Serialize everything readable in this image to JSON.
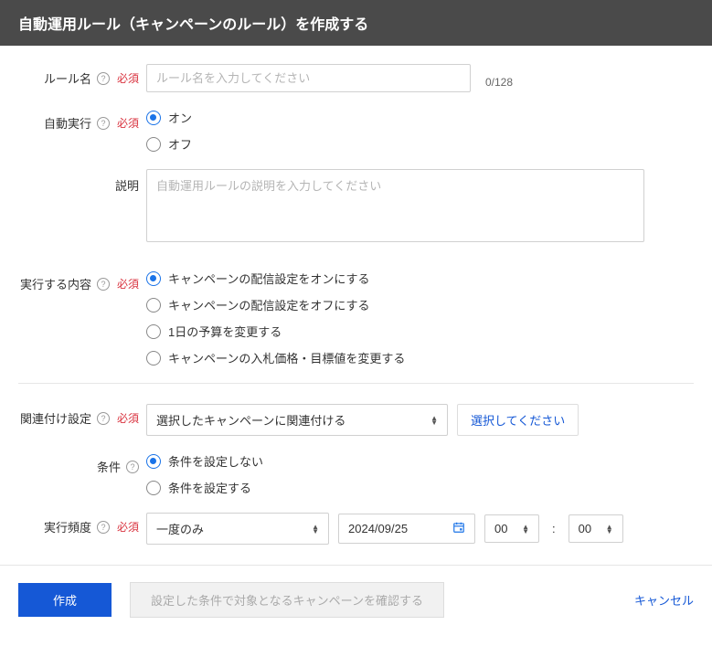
{
  "header": {
    "title": "自動運用ルール（キャンペーンのルール）を作成する"
  },
  "labels": {
    "rule_name": "ルール名",
    "auto_exec": "自動実行",
    "description": "説明",
    "exec_content": "実行する内容",
    "association": "関連付け設定",
    "conditions": "条件",
    "frequency": "実行頻度"
  },
  "required": "必須",
  "rule_name": {
    "placeholder": "ルール名を入力してください",
    "counter": "0/128"
  },
  "auto_exec": {
    "on": "オン",
    "off": "オフ"
  },
  "description": {
    "placeholder": "自動運用ルールの説明を入力してください"
  },
  "exec_content": {
    "opt1": "キャンペーンの配信設定をオンにする",
    "opt2": "キャンペーンの配信設定をオフにする",
    "opt3": "1日の予算を変更する",
    "opt4": "キャンペーンの入札価格・目標値を変更する"
  },
  "association": {
    "select_value": "選択したキャンペーンに関連付ける",
    "pick_button": "選択してください"
  },
  "conditions": {
    "none": "条件を設定しない",
    "set": "条件を設定する"
  },
  "frequency": {
    "mode": "一度のみ",
    "date": "2024/09/25",
    "hour": "00",
    "minute": "00",
    "colon": ":"
  },
  "footer": {
    "create": "作成",
    "preview": "設定した条件で対象となるキャンペーンを確認する",
    "cancel": "キャンセル"
  }
}
